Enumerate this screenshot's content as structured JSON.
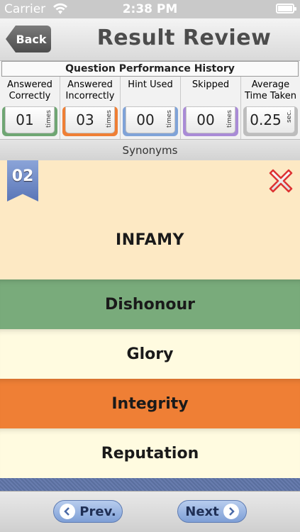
{
  "status_bar": {
    "carrier": "Carrier",
    "time": "2:38 PM"
  },
  "nav": {
    "back_label": "Back",
    "title": "Result Review"
  },
  "history": {
    "title": "Question Performance History",
    "stats": [
      {
        "label_line1": "Answered",
        "label_line2": "Correctly",
        "value": "01",
        "unit": "times",
        "color": "#6fa673"
      },
      {
        "label_line1": "Answered",
        "label_line2": "Incorrectly",
        "value": "03",
        "unit": "times",
        "color": "#ef7f35"
      },
      {
        "label_line1": "Hint Used",
        "label_line2": "",
        "value": "00",
        "unit": "times",
        "color": "#7fa3d8"
      },
      {
        "label_line1": "Skipped",
        "label_line2": "",
        "value": "00",
        "unit": "times",
        "color": "#a98bd6"
      },
      {
        "label_line1": "Average",
        "label_line2": "Time Taken",
        "value": "0.25",
        "unit": "sec.",
        "color": "#bdbdbd"
      }
    ]
  },
  "category": "Synonyms",
  "question": {
    "number": "02",
    "word": "INFAMY"
  },
  "options": [
    {
      "label": "Dishonour",
      "color": "#79ab7b"
    },
    {
      "label": "Glory",
      "color": "#fffbe0"
    },
    {
      "label": "Integrity",
      "color": "#ef7f35"
    },
    {
      "label": "Reputation",
      "color": "#fffbe0"
    }
  ],
  "footer": {
    "prev_label": "Prev.",
    "next_label": "Next"
  }
}
